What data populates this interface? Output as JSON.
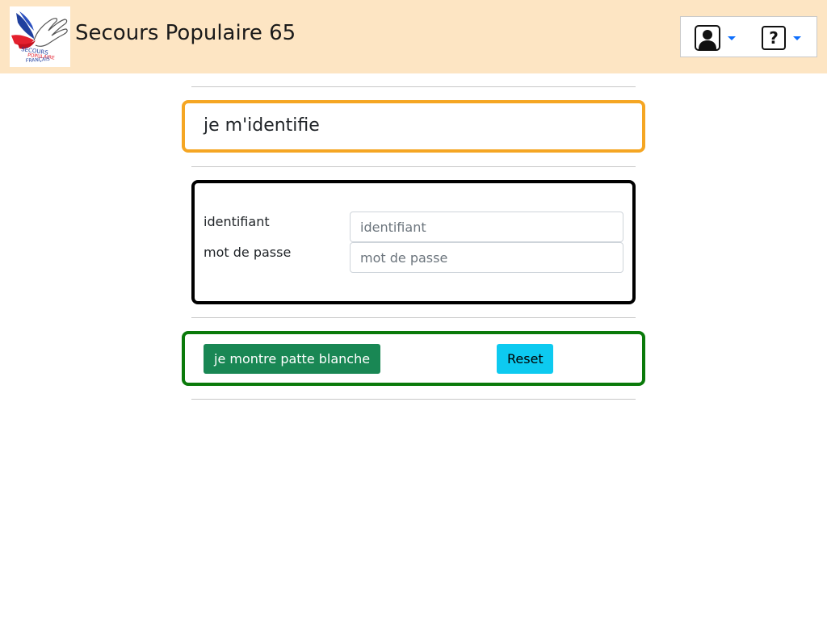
{
  "header": {
    "app_title": "Secours Populaire 65",
    "logo": {
      "icon": "secours-populaire-logo",
      "text_lines": [
        "SECOURS",
        "POPULAIRE",
        "FRANÇAIS"
      ]
    },
    "user_menu": {
      "icon": "user-icon"
    },
    "help_menu": {
      "icon": "help-icon",
      "glyph": "?"
    }
  },
  "login": {
    "title": "je m'identifie",
    "fields": [
      {
        "label": "identifiant",
        "value": "",
        "placeholder": "identifiant"
      },
      {
        "label": "mot de passe",
        "value": "",
        "placeholder": "mot de passe"
      }
    ],
    "submit_label": "je montre patte blanche",
    "reset_label": "Reset"
  },
  "colors": {
    "header_bg": "#fde5c3",
    "title_border": "#f5a623",
    "form_border": "#000000",
    "actions_border": "#0a7a0a",
    "submit_bg": "#198754",
    "reset_bg": "#0dcaf0",
    "caret": "#0d6efd"
  }
}
